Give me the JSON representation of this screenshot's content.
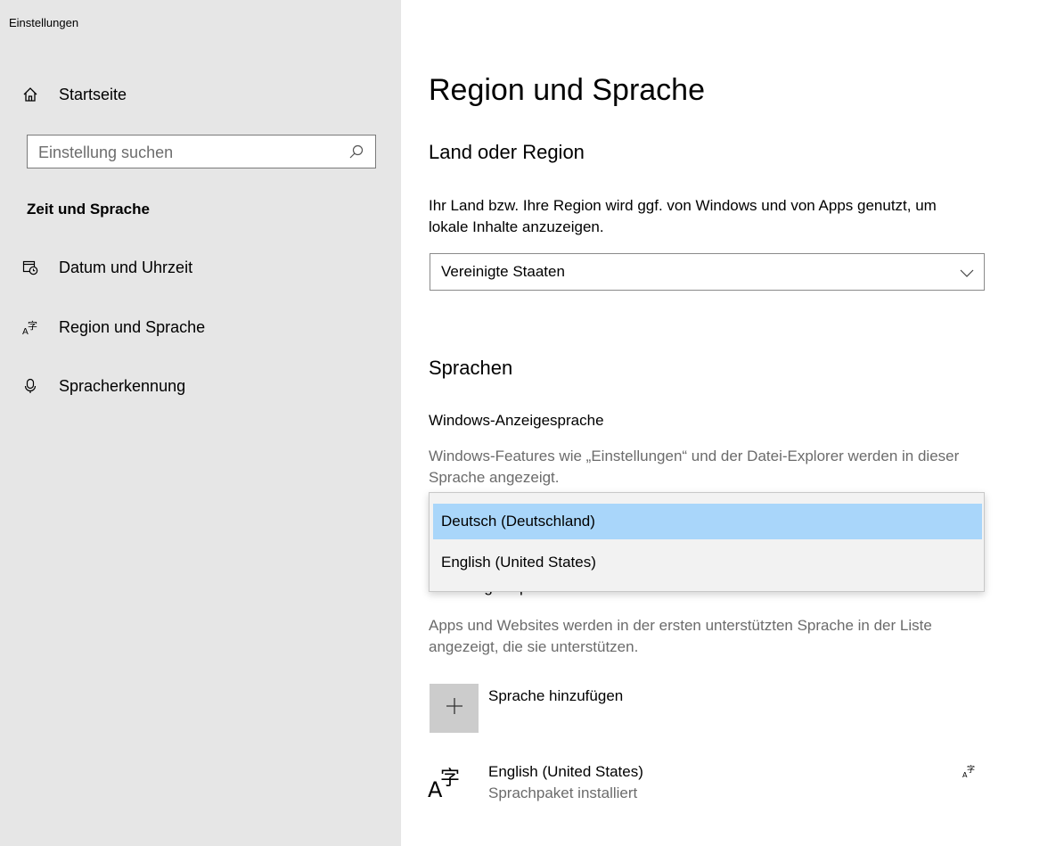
{
  "window": {
    "title": "Einstellungen"
  },
  "sidebar": {
    "home_label": "Startseite",
    "search_placeholder": "Einstellung suchen",
    "section_title": "Zeit und Sprache",
    "items": [
      {
        "label": "Datum und Uhrzeit",
        "icon": "calendar-clock-icon"
      },
      {
        "label": "Region und Sprache",
        "icon": "language-icon"
      },
      {
        "label": "Spracherkennung",
        "icon": "microphone-icon"
      }
    ]
  },
  "main": {
    "title": "Region und Sprache",
    "country": {
      "heading": "Land oder Region",
      "description": "Ihr Land bzw. Ihre Region wird ggf. von Windows und von Apps genutzt, um lokale Inhalte anzuzeigen.",
      "selected": "Vereinigte Staaten"
    },
    "languages": {
      "heading": "Sprachen",
      "display_language_title": "Windows-Anzeigesprache",
      "display_language_desc": "Windows-Features wie „Einstellungen“ und der Datei-Explorer werden in dieser Sprache angezeigt.",
      "dropdown_options": [
        "Deutsch (Deutschland)",
        "English (United States)"
      ],
      "dropdown_selected": "Deutsch (Deutschland)",
      "preferred_title": "Bevorzugte Sprachen",
      "preferred_desc": "Apps und Websites werden in der ersten unterstützten Sprache in der Liste angezeigt, die sie unterstützen.",
      "add_language_label": "Sprache hinzufügen",
      "installed": [
        {
          "name": "English (United States)",
          "status": "Sprachpaket installiert"
        }
      ]
    }
  },
  "colors": {
    "sidebar_bg": "#e6e6e6",
    "selected_option_bg": "#a9d6fa",
    "muted_text": "#6b6b6b",
    "add_button_bg": "#cccccc"
  }
}
